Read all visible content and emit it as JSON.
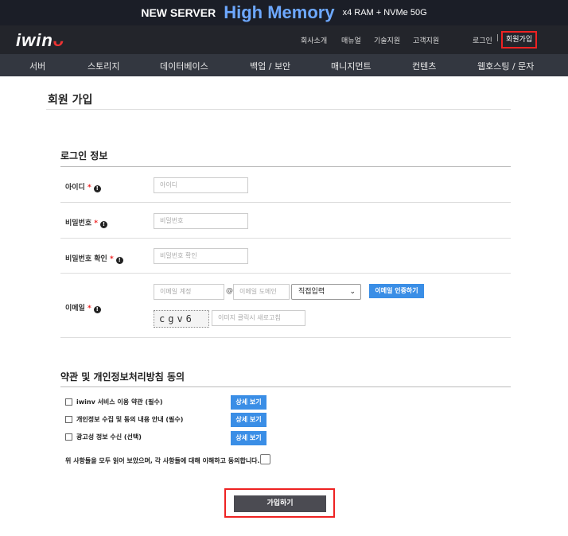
{
  "banner": {
    "new_server": "NEW SERVER",
    "high_memory": "High Memory",
    "spec": "x4 RAM + NVMe 50G"
  },
  "header": {
    "logo": "iwin",
    "top_links": [
      "회사소개",
      "매뉴얼",
      "기술지원",
      "고객지원"
    ],
    "login": "로그인",
    "separator": "|",
    "signup": "회원가입"
  },
  "main_nav": [
    "서버",
    "스토리지",
    "데이터베이스",
    "백업 / 보안",
    "매니지먼트",
    "컨텐츠",
    "웹호스팅 / 문자"
  ],
  "page": {
    "title": "회원 가입"
  },
  "login_info": {
    "title": "로그인 정보",
    "required_mark": "*",
    "info_glyph": "!",
    "id_label": "아이디",
    "id_placeholder": "아이디",
    "pw_label": "비밀번호",
    "pw_placeholder": "비밀번호",
    "pw_confirm_label": "비밀번호 확인",
    "pw_confirm_placeholder": "비밀번호 확인",
    "email_label": "이메일",
    "email_account_placeholder": "이메일 계정",
    "at": "@",
    "email_domain_placeholder": "이메일 도메인",
    "domain_select": "직접입력",
    "verify_button": "이메일 인증하기",
    "captcha_text": "cgv6",
    "captcha_placeholder": "이미지 클릭시 새로고침"
  },
  "terms": {
    "title": "약관 및 개인정보처리방침 동의",
    "items": [
      {
        "label": "iwinv 서비스 이용 약관 (필수)",
        "button": "상세 보기"
      },
      {
        "label": "개인정보 수집 및 동의 내용 안내 (필수)",
        "button": "상세 보기"
      },
      {
        "label": "광고성 정보 수신 (선택)",
        "button": "상세 보기"
      }
    ],
    "agree_all": "위 사항들을 모두 읽어 보았으며, 각 사항들에 대해 이해하고 동의합니다."
  },
  "submit": "가입하기",
  "colors": {
    "accent_blue": "#3a8ee6",
    "highlight_red": "#e22222",
    "header_bg": "#23252b"
  }
}
